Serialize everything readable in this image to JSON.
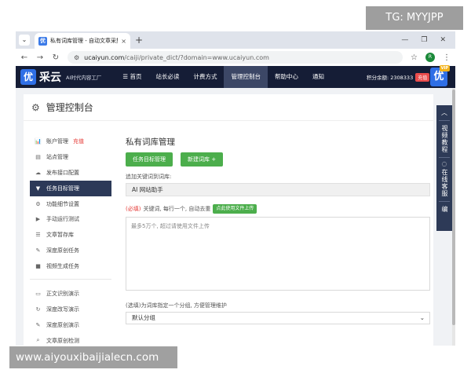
{
  "watermarks": {
    "top": "TG: MYYJPP",
    "bottom": "www.aiyouxibaijialecn.com"
  },
  "browser": {
    "tab_title": "私有词库管理 - 自动文章采集/",
    "tab_close": "×",
    "new_tab": "+",
    "favicon": "优",
    "url_host": "ucaiyun.com",
    "url_path": "/caiji/private_dict/?domain=www.ucaiyun.com",
    "profile_initial": "R"
  },
  "site": {
    "logo_badge": "优",
    "logo_name": "采云",
    "slogan": "AI时代内容工厂",
    "nav": [
      {
        "label": "☰ 首页"
      },
      {
        "label": "站长必读"
      },
      {
        "label": "计费方式"
      },
      {
        "label": "管理控制台"
      },
      {
        "label": "帮助中心"
      },
      {
        "label": "通知"
      }
    ],
    "points_label": "积分余额: 2308333",
    "recharge_label": "充值",
    "vip_badge": "优",
    "vip_tag": "VIP"
  },
  "console": {
    "title": "管理控制台",
    "sidebar": [
      {
        "icon": "📊",
        "label": "账户管理",
        "badge": "充值"
      },
      {
        "icon": "▤",
        "label": "站点管理"
      },
      {
        "icon": "☁",
        "label": "发布接口配置"
      },
      {
        "icon": "▼",
        "label": "任务目标管理"
      },
      {
        "icon": "⚙",
        "label": "功能细节设置"
      },
      {
        "icon": "▶",
        "label": "手动运行测试"
      },
      {
        "icon": "☰",
        "label": "文章暂存库"
      },
      {
        "icon": "✎",
        "label": "深度原创任务"
      },
      {
        "icon": "■",
        "label": "视频生成任务"
      }
    ],
    "sidebar_tools": [
      {
        "icon": "▭",
        "label": "正文识别演示"
      },
      {
        "icon": "↻",
        "label": "深度改写演示"
      },
      {
        "icon": "✎",
        "label": "深度原创演示"
      },
      {
        "icon": "⌕",
        "label": "文章原创检测"
      }
    ]
  },
  "main": {
    "title": "私有词库管理",
    "btn_task": "任务目标管理",
    "btn_new": "新建词库 +",
    "add_label": "追加关键词到词库:",
    "dict_value": "AI 网站助手",
    "kw_required": "(必填)",
    "kw_label": "关键词, 每行一个, 自动去重",
    "upload_btn": "点此使用文件上传",
    "textarea_placeholder": "最多5万个, 超过请使用文件上传",
    "group_label": "(选填)为词库指定一个分组, 方便管理维护",
    "group_value": "默认分组"
  },
  "float_panel": {
    "video": "视频教程",
    "service": "在线客服",
    "code": "编"
  }
}
